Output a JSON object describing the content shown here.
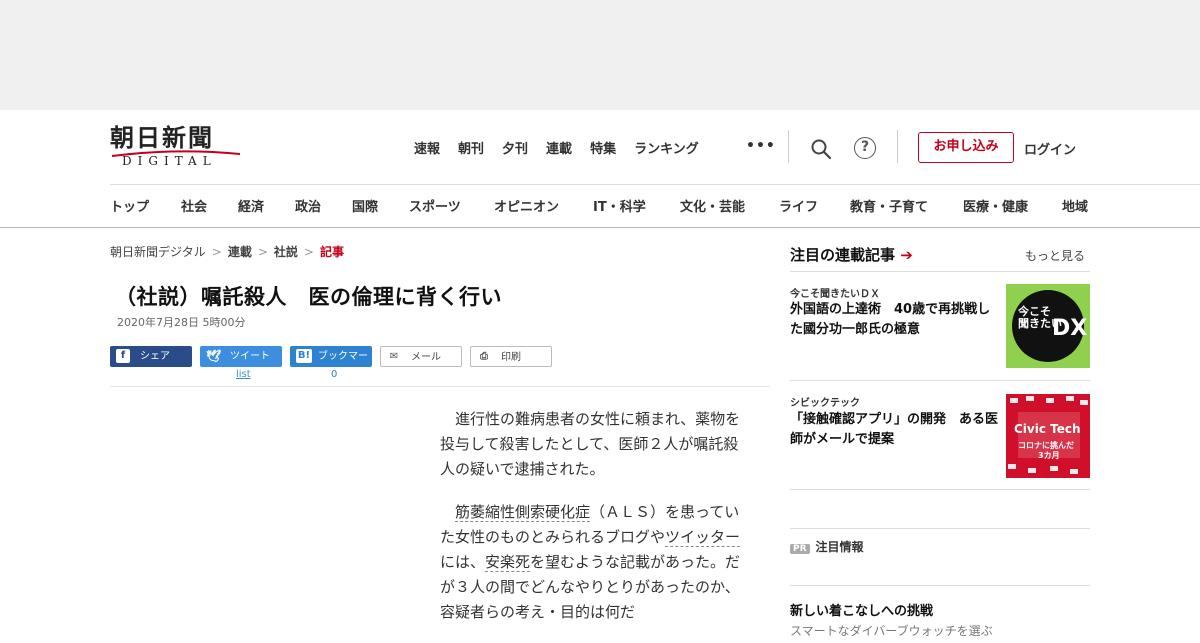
{
  "header": {
    "logo_jp": "朝日新聞",
    "logo_en": "DIGITAL",
    "topnav": [
      "速報",
      "朝刊",
      "夕刊",
      "連載",
      "特集",
      "ランキング"
    ],
    "more": "•••",
    "subscribe": "お申し込み",
    "login": "ログイン",
    "help": "?"
  },
  "catnav": [
    "トップ",
    "社会",
    "経済",
    "政治",
    "国際",
    "スポーツ",
    "オピニオン",
    "IT・科学",
    "文化・芸能",
    "ライフ",
    "教育・子育て",
    "医療・健康",
    "地域"
  ],
  "breadcrumb": [
    "朝日新聞デジタル",
    "連載",
    "社説",
    "記事"
  ],
  "article": {
    "title": "（社説）嘱託殺人　医の倫理に背く行い",
    "date": "2020年7月28日 5時00分",
    "share": {
      "facebook": "シェア",
      "twitter": "ツイート",
      "hatena": "ブックマーク",
      "mail": "メール",
      "print": "印刷",
      "twitter_count": "list",
      "hatena_count": "0"
    },
    "p1": "進行性の難病患者の女性に頼まれ、薬物を投与して殺害したとして、医師２人が嘱託殺人の疑いで逮捕された。",
    "p2_kw1": "筋萎縮性側索硬化症",
    "p2_a": "（ＡＬＳ）を患っていた女性のものとみられるブログや",
    "p2_kw2": "ツイッター",
    "p2_b": "には、",
    "p2_kw3": "安楽死",
    "p2_c": "を望むような記載があった。だが３人の間でどんなやりとりがあったのか、容疑者らの考え・目的は何だ"
  },
  "sidebar": {
    "heading": "注目の連載記事",
    "arrow": "➔",
    "more": "もっと見る",
    "items": [
      {
        "category": "今こそ聞きたいＤＸ",
        "title": "外国語の上達術　40歳で再挑戦した國分功一郎氏の極意",
        "thumb_text_1": "今こそ",
        "thumb_text_2": "聞きたい",
        "thumb_text_3": "DX"
      },
      {
        "category": "シビックテック",
        "title": "「接触確認アプリ」の開発　ある医師がメールで提案",
        "thumb_text_1": "Civic Tech",
        "thumb_text_2": "コロナに挑んだ",
        "thumb_text_3": "3カ月"
      }
    ],
    "pr_badge": "PR",
    "pr_label": "注目情報",
    "pr_title": "新しい着こなしへの挑戦",
    "pr_sub": "スマートなダイバーブウォッチを選ぶ"
  },
  "colors": {
    "brand_red": "#c4001a",
    "facebook": "#2a4d8a",
    "twitter": "#3d8ede",
    "hatena": "#2e82d2",
    "dx_green": "#8fd14f"
  }
}
